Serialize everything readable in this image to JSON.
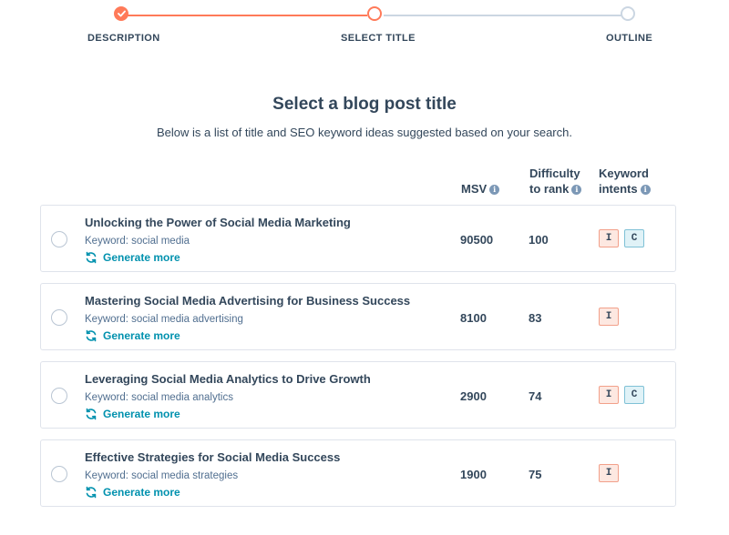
{
  "stepper": {
    "steps": [
      {
        "label": "DESCRIPTION",
        "state": "done"
      },
      {
        "label": "SELECT TITLE",
        "state": "active"
      },
      {
        "label": "OUTLINE",
        "state": "todo"
      }
    ]
  },
  "header": {
    "title": "Select a blog post title",
    "subtitle": "Below is a list of title and SEO keyword ideas suggested based on your search."
  },
  "columns": {
    "msv": "MSV",
    "difficulty_line1": "Difficulty",
    "difficulty_line2": "to rank",
    "intents_line1": "Keyword",
    "intents_line2": "intents",
    "info_glyph": "i"
  },
  "rows": [
    {
      "title": "Unlocking the Power of Social Media Marketing",
      "keyword": "Keyword: social media",
      "generate": "Generate more",
      "msv": "90500",
      "difficulty": "100",
      "intents": [
        "I",
        "C"
      ]
    },
    {
      "title": "Mastering Social Media Advertising for Business Success",
      "keyword": "Keyword: social media advertising",
      "generate": "Generate more",
      "msv": "8100",
      "difficulty": "83",
      "intents": [
        "I"
      ]
    },
    {
      "title": "Leveraging Social Media Analytics to Drive Growth",
      "keyword": "Keyword: social media analytics",
      "generate": "Generate more",
      "msv": "2900",
      "difficulty": "74",
      "intents": [
        "I",
        "C"
      ]
    },
    {
      "title": "Effective Strategies for Social Media Success",
      "keyword": "Keyword: social media strategies",
      "generate": "Generate more",
      "msv": "1900",
      "difficulty": "75",
      "intents": [
        "I"
      ]
    }
  ],
  "colors": {
    "accent": "#ff7a59",
    "link": "#0091ae",
    "text": "#33475b"
  },
  "icons": {
    "done": "check-icon",
    "regenerate": "refresh-icon",
    "info": "info-icon"
  }
}
